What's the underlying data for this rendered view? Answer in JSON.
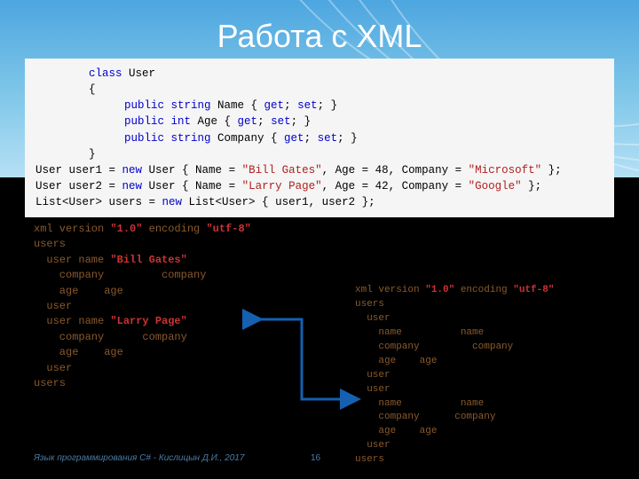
{
  "title": "Работа с XML",
  "code": {
    "l1a": "class",
    "l1b": " User",
    "l2": "{",
    "l3a": "public",
    "l3b": " string",
    "l3c": " Name { ",
    "l3d": "get",
    "l3e": "; ",
    "l3f": "set",
    "l3g": "; }",
    "l4a": "public",
    "l4b": " int",
    "l4c": " Age { ",
    "l4d": "get",
    "l4e": "; ",
    "l4f": "set",
    "l4g": "; }",
    "l5a": "public",
    "l5b": " string",
    "l5c": " Company { ",
    "l5d": "get",
    "l5e": "; ",
    "l5f": "set",
    "l5g": "; }",
    "l6": "}",
    "l7a": "User user1 = ",
    "l7b": "new",
    "l7c": " User { Name = ",
    "l7d": "\"Bill Gates\"",
    "l7e": ", Age = 48, Company = ",
    "l7f": "\"Microsoft\"",
    "l7g": " };",
    "l8a": "User user2 = ",
    "l8b": "new",
    "l8c": " User { Name = ",
    "l8d": "\"Larry Page\"",
    "l8e": ", Age = 42, Company = ",
    "l8f": "\"Google\"",
    "l8g": " };",
    "l9a": "List<User> users = ",
    "l9b": "new",
    "l9c": " List<User> { user1, user2 };"
  },
  "xmlL": {
    "r1a": " xml version ",
    "r1b": "\"1.0\"",
    "r1c": " encoding ",
    "r1d": "\"utf-8\"",
    "r2": "users",
    "r3a": "  user name ",
    "r3b": "\"Bill Gates\"",
    "r4a": "    company",
    "r4b": "         company",
    "r5a": "    age",
    "r5b": "    age",
    "r6": "  user",
    "r7a": "  user name ",
    "r7b": "\"Larry Page\"",
    "r8a": "    company",
    "r8b": "      company",
    "r9a": "    age",
    "r9b": "    age",
    "r10": "  user",
    "r11": "users"
  },
  "xmlR": {
    "r1a": " xml version ",
    "r1b": "\"1.0\"",
    "r1c": " encoding ",
    "r1d": "\"utf-8\"",
    "r2": "users",
    "r3": "  user",
    "r4a": "    name",
    "r4b": "          name",
    "r5a": "    company",
    "r5b": "         company",
    "r6a": "    age",
    "r6b": "    age",
    "r7": "  user",
    "r8": "  user",
    "r9a": "    name",
    "r9b": "          name",
    "r10a": "    company",
    "r10b": "      company",
    "r11a": "    age",
    "r11b": "    age",
    "r12": "  user",
    "r13": "users"
  },
  "footer": "Язык программирования C# - Кислицын Д.И., 2017",
  "page": "16"
}
